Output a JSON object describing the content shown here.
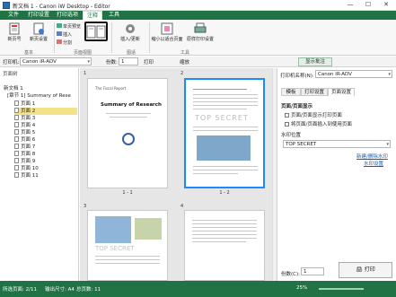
{
  "window": {
    "title": "新文档 1 - Canon iW Desktop - Editor",
    "minimize": "—",
    "maximize": "☐",
    "close": "✕"
  },
  "ribbon_tabs": [
    "文件",
    "打印设置",
    "打印选项",
    "注释",
    "工具"
  ],
  "ribbon": {
    "new_doc": "新页号",
    "add_doc": "新页设置",
    "groups": {
      "basic": "基本",
      "view": "页面视图",
      "fit": "图适",
      "tools": "工具"
    },
    "view_btn1": "单页预览",
    "view_btn2": "插入",
    "view_btn3": "分割",
    "insert_btn": "插入/更新",
    "fit_btn": "缩小以适合页面",
    "print_set_btn": "原样打印设置"
  },
  "toolbar": {
    "printer_label": "打印机:",
    "printer_value": "Canon iR-ADV",
    "copies_label": "份数:",
    "copies_value": "1",
    "print_label": "打印",
    "zoom_label": "缩放",
    "show_panel": "显示批注"
  },
  "left_pane": {
    "title": "页面树",
    "doc_node": "新文档 1",
    "chapter_node": "[章节 1] Summary of Rese",
    "pages": [
      "页面 1",
      "页面 2",
      "页面 3",
      "页面 4",
      "页面 5",
      "页面 6",
      "页面 7",
      "页面 8",
      "页面 9",
      "页面 10",
      "页面 11"
    ]
  },
  "center": {
    "pages": [
      {
        "num": "1",
        "label": "1 - 1",
        "heading": "Summary of Research",
        "sub": "The Fiscal Report"
      },
      {
        "num": "2",
        "label": "1 - 2",
        "watermark": "TOP SECRET"
      },
      {
        "num": "3",
        "label": "",
        "watermark": "TOP SECRET"
      },
      {
        "num": "4",
        "label": ""
      }
    ]
  },
  "right_pane": {
    "printer_label": "打印机名称(N):",
    "printer_value": "Canon iR-ADV",
    "tabs": [
      "模板",
      "打印设置",
      "页面设置"
    ],
    "section": "页面/页面显示",
    "opt1": "页面/页面显示打印页面",
    "opt2": "将页面/页面插入到使用页面",
    "watermark_label": "水印位置",
    "watermark_value": "TOP SECRET",
    "link1": "新建/删除水印",
    "link2": "水印设置",
    "copies_label": "份数(C):",
    "copies_value": "1",
    "print_btn": "打印"
  },
  "status": {
    "left": "所选页面: 2/11",
    "mid": "输出尺寸: A4",
    "mid2": "总页数: 11",
    "zoom": "25%"
  }
}
